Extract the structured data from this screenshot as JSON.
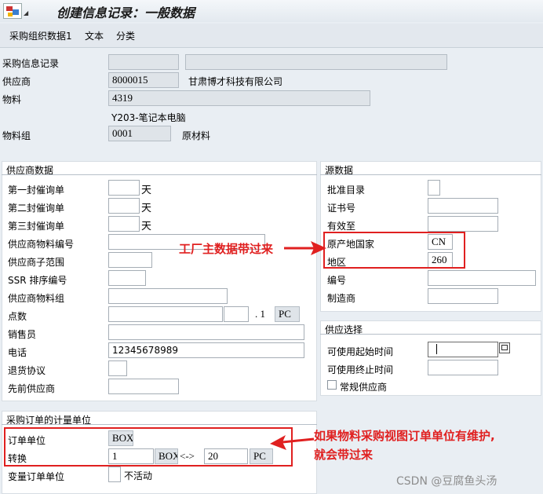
{
  "window": {
    "title": "创建信息记录：一般数据"
  },
  "menu": [
    "采购组织数据1",
    "文本",
    "分类"
  ],
  "header": {
    "info_record_label": "采购信息记录",
    "vendor_label": "供应商",
    "vendor_value": "8000015",
    "vendor_name": "甘肃博才科技有限公司",
    "material_label": "物料",
    "material_value": "4319",
    "material_desc": "Y203-笔记本电脑",
    "matgroup_label": "物料组",
    "matgroup_value": "0001",
    "matgroup_name": "原材料"
  },
  "vendor_data": {
    "title": "供应商数据",
    "reminder1": "第一封催询单",
    "reminder2": "第二封催询单",
    "reminder3": "第三封催询单",
    "day_unit": "天",
    "vendor_material_no": "供应商物料编号",
    "vendor_subrange": "供应商子范围",
    "ssr_sort": "SSR 排序编号",
    "vendor_matgroup": "供应商物料组",
    "points": "点数",
    "points_per": ". 1",
    "points_unit": "PC",
    "salesperson": "销售员",
    "phone_label": "电话",
    "phone_value": "12345678989",
    "return_agreement": "退货协议",
    "prior_vendor": "先前供应商"
  },
  "source_data": {
    "title": "源数据",
    "catalog": "批准目录",
    "cert_no": "证书号",
    "valid_to": "有效至",
    "origin_country_label": "原产地国家",
    "origin_country_value": "CN",
    "region_label": "地区",
    "region_value": "260",
    "number": "编号",
    "manufacturer": "制造商"
  },
  "supply_option": {
    "title": "供应选择",
    "avail_from": "可使用起始时间",
    "avail_to": "可使用终止时间",
    "regular_vendor": "常规供应商"
  },
  "order_unit": {
    "title": "采购订单的计量单位",
    "order_unit_label": "订单单位",
    "order_unit_value": "BOX",
    "conversion_label": "转换",
    "conv_qty": "1",
    "conv_unit1": "BOX",
    "conv_arrow": "<->",
    "conv_qty2": "20",
    "conv_unit2": "PC",
    "var_unit_label": "变量订单单位",
    "var_unit_status": "不活动"
  },
  "annotations": {
    "plant_note": "工厂主数据带过来",
    "unit_note_line1": "如果物料采购视图订单单位有维护,",
    "unit_note_line2": "就会带过来",
    "watermark": "CSDN @豆腐鱼头汤"
  },
  "colors": {
    "annotation": "#e02020",
    "background": "#e9eef3"
  }
}
